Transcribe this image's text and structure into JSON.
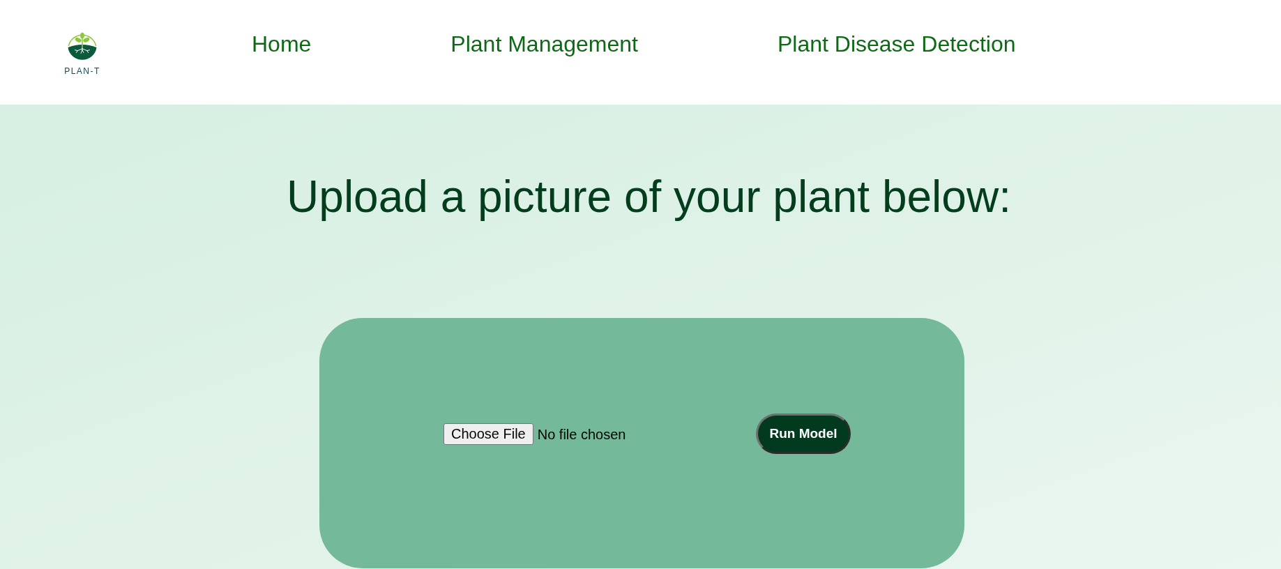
{
  "logo": {
    "text": "PLAN-T"
  },
  "nav": [
    {
      "label": "Home"
    },
    {
      "label": "Plant Management"
    },
    {
      "label": "Plant Disease Detection"
    }
  ],
  "heading": "Upload a picture of your plant below:",
  "upload": {
    "choose_button": "Choose File",
    "file_status": "No file chosen",
    "run_button": "Run Model"
  }
}
